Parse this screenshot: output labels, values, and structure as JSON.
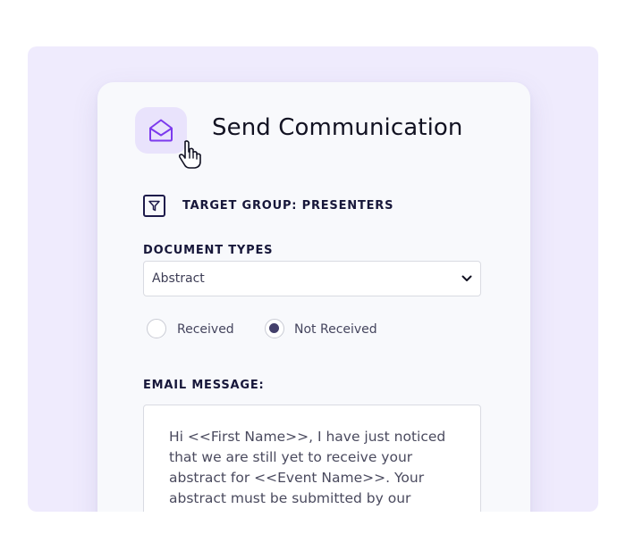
{
  "header": {
    "title": "Send Communication",
    "icon": "envelope-open-icon",
    "cursor": "hand-pointer-icon",
    "accent_color": "#7c3aed"
  },
  "target_group": {
    "icon": "filter-icon",
    "label": "TARGET GROUP: PRESENTERS"
  },
  "document_types": {
    "label": "DOCUMENT TYPES",
    "selected": "Abstract"
  },
  "status_options": [
    {
      "label": "Received",
      "selected": false
    },
    {
      "label": "Not Received",
      "selected": true
    }
  ],
  "email": {
    "label": "EMAIL MESSAGE:",
    "body": "Hi <<First Name>>, I have just noticed that we are still yet to receive your abstract for <<Event Name>>. Your abstract must be submitted by our deadline of Friday"
  }
}
